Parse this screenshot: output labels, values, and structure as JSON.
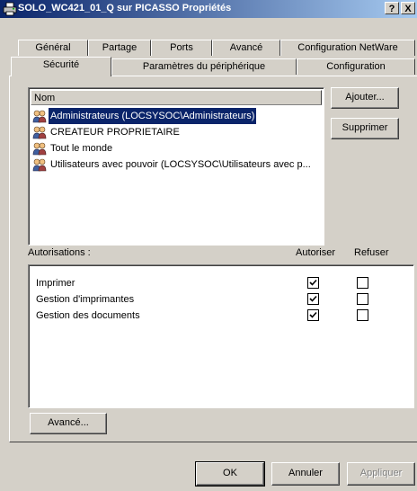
{
  "window": {
    "title": "SOLO_WC421_01_Q sur PICASSO Propriétés",
    "help_label": "?",
    "close_label": "X",
    "printer_icon": "printer-icon"
  },
  "tabs": {
    "row1": [
      "Général",
      "Partage",
      "Ports",
      "Avancé",
      "Configuration NetWare"
    ],
    "row2": [
      "Sécurité",
      "Paramètres du périphérique",
      "Configuration"
    ],
    "active": "Sécurité"
  },
  "users": {
    "header": "Nom",
    "items": [
      {
        "label": "Administrateurs (LOCSYSOC\\Administrateurs)",
        "icon": "group-icon",
        "selected": true
      },
      {
        "label": "CREATEUR PROPRIETAIRE",
        "icon": "group-icon",
        "selected": false
      },
      {
        "label": "Tout le monde",
        "icon": "group-icon",
        "selected": false
      },
      {
        "label": "Utilisateurs avec pouvoir (LOCSYSOC\\Utilisateurs avec p...",
        "icon": "group-icon",
        "selected": false
      }
    ],
    "add_label": "Ajouter...",
    "remove_label": "Supprimer"
  },
  "permissions": {
    "label": "Autorisations :",
    "allow_header": "Autoriser",
    "deny_header": "Refuser",
    "rows": [
      {
        "name": "Imprimer",
        "allow": true,
        "deny": false
      },
      {
        "name": "Gestion d'imprimantes",
        "allow": true,
        "deny": false
      },
      {
        "name": "Gestion des documents",
        "allow": true,
        "deny": false
      }
    ]
  },
  "advanced_label": "Avancé...",
  "footer": {
    "ok_label": "OK",
    "cancel_label": "Annuler",
    "apply_label": "Appliquer"
  },
  "colors": {
    "selection": "#0a246a",
    "face": "#d4d0c8",
    "disabled_text": "#808080"
  }
}
